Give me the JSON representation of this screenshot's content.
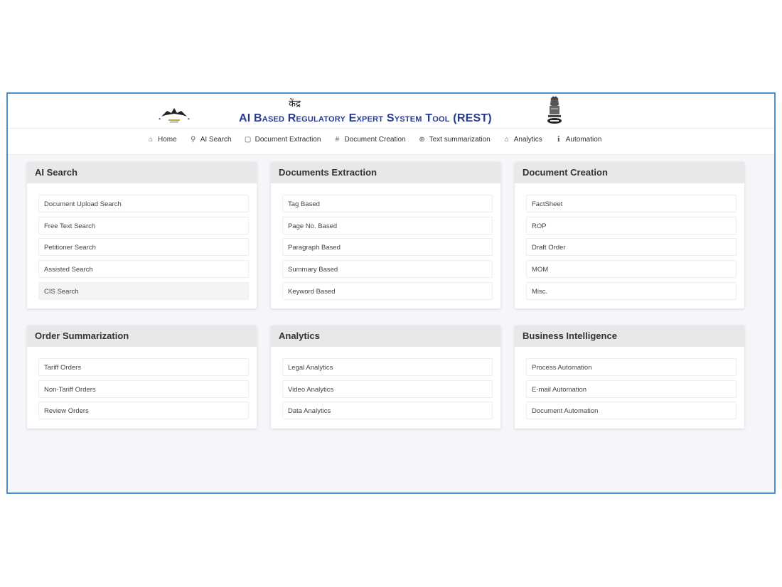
{
  "header": {
    "hindi_text": "केंद्र",
    "app_title": "AI Based Regulatory Expert System Tool (REST)"
  },
  "nav": [
    {
      "icon": "home-icon",
      "glyph": "⌂",
      "label": "Home"
    },
    {
      "icon": "search-icon",
      "glyph": "⚲",
      "label": "AI Search"
    },
    {
      "icon": "document-icon",
      "glyph": "▢",
      "label": "Document Extraction"
    },
    {
      "icon": "hash-icon",
      "glyph": "#",
      "label": "Document Creation"
    },
    {
      "icon": "globe-icon",
      "glyph": "⊕",
      "label": "Text summarization"
    },
    {
      "icon": "analytics-icon",
      "glyph": "⌂",
      "label": "Analytics"
    },
    {
      "icon": "info-icon",
      "glyph": "ℹ",
      "label": "Automation"
    }
  ],
  "cards": [
    {
      "title": "AI Search",
      "items": [
        "Document Upload Search",
        "Free Text Search",
        "Petitioner Search",
        "Assisted Search",
        "CIS Search"
      ]
    },
    {
      "title": "Documents Extraction",
      "items": [
        "Tag Based",
        "Page No. Based",
        "Paragraph Based",
        "Summary Based",
        "Keyword Based"
      ]
    },
    {
      "title": "Document Creation",
      "items": [
        "FactSheet",
        "ROP",
        "Draft Order",
        "MOM",
        "Misc."
      ]
    },
    {
      "title": "Order Summarization",
      "items": [
        "Tariff Orders",
        "Non-Tariff Orders",
        "Review Orders"
      ]
    },
    {
      "title": "Analytics",
      "items": [
        "Legal Analytics",
        "Video Analytics",
        "Data Analytics"
      ]
    },
    {
      "title": "Business Intelligence",
      "items": [
        "Process Automation",
        "E-mail Automation",
        "Document Automation"
      ]
    }
  ],
  "colors": {
    "title_blue": "#2a3b8f",
    "frame_border": "#4a8fd0",
    "card_header_bg": "#e9e7e8"
  }
}
